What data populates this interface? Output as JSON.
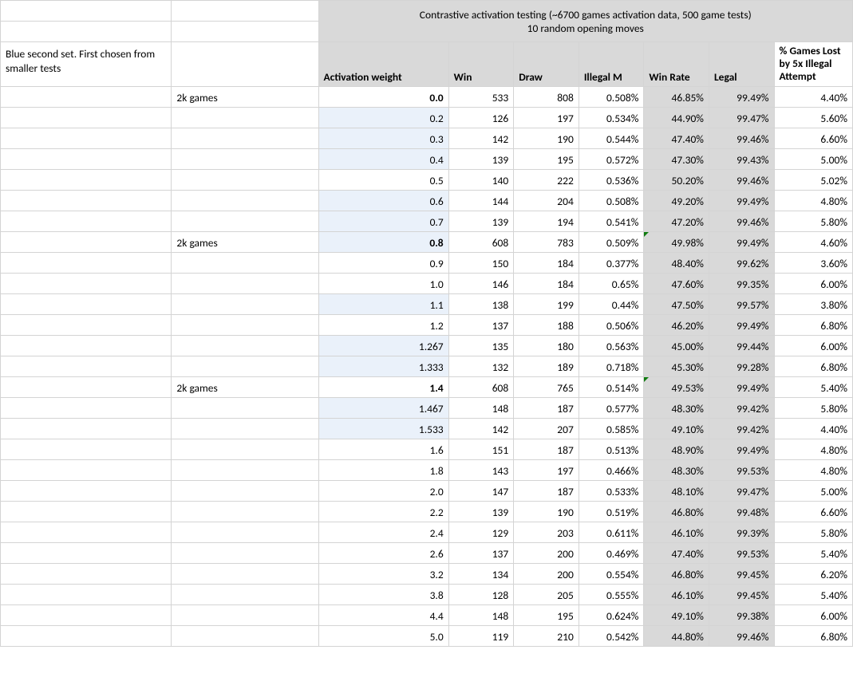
{
  "header": {
    "title_line1": "Contrastive activation testing (~6700 games activation data, 500 game tests)",
    "title_line2": "10 random opening moves",
    "note": "Blue second set. First chosen from smaller tests"
  },
  "columns": {
    "activation": "Activation weight",
    "win": "Win",
    "draw": "Draw",
    "illegal": "Illegal M",
    "winrate": "Win Rate",
    "legal": "Legal",
    "lost": "% Games Lost by 5x Illegal Attempt"
  },
  "games_label": "2k games",
  "rows": [
    {
      "games": "2k games",
      "act": "0.0",
      "win": "533",
      "draw": "808",
      "ill": "0.508%",
      "wr": "46.85%",
      "legal": "99.49%",
      "lost": "4.40%",
      "bold": true,
      "hl": false,
      "mark": false
    },
    {
      "games": "",
      "act": "0.2",
      "win": "126",
      "draw": "197",
      "ill": "0.534%",
      "wr": "44.90%",
      "legal": "99.47%",
      "lost": "5.60%",
      "bold": false,
      "hl": true,
      "mark": false
    },
    {
      "games": "",
      "act": "0.3",
      "win": "142",
      "draw": "190",
      "ill": "0.544%",
      "wr": "47.40%",
      "legal": "99.46%",
      "lost": "6.60%",
      "bold": false,
      "hl": true,
      "mark": false
    },
    {
      "games": "",
      "act": "0.4",
      "win": "139",
      "draw": "195",
      "ill": "0.572%",
      "wr": "47.30%",
      "legal": "99.43%",
      "lost": "5.00%",
      "bold": false,
      "hl": true,
      "mark": false
    },
    {
      "games": "",
      "act": "0.5",
      "win": "140",
      "draw": "222",
      "ill": "0.536%",
      "wr": "50.20%",
      "legal": "99.46%",
      "lost": "5.02%",
      "bold": false,
      "hl": false,
      "mark": false
    },
    {
      "games": "",
      "act": "0.6",
      "win": "144",
      "draw": "204",
      "ill": "0.508%",
      "wr": "49.20%",
      "legal": "99.49%",
      "lost": "4.80%",
      "bold": false,
      "hl": true,
      "mark": false
    },
    {
      "games": "",
      "act": "0.7",
      "win": "139",
      "draw": "194",
      "ill": "0.541%",
      "wr": "47.20%",
      "legal": "99.46%",
      "lost": "5.80%",
      "bold": false,
      "hl": true,
      "mark": false
    },
    {
      "games": "2k games",
      "act": "0.8",
      "win": "608",
      "draw": "783",
      "ill": "0.509%",
      "wr": "49.98%",
      "legal": "99.49%",
      "lost": "4.60%",
      "bold": true,
      "hl": true,
      "mark": true
    },
    {
      "games": "",
      "act": "0.9",
      "win": "150",
      "draw": "184",
      "ill": "0.377%",
      "wr": "48.40%",
      "legal": "99.62%",
      "lost": "3.60%",
      "bold": false,
      "hl": false,
      "mark": false
    },
    {
      "games": "",
      "act": "1.0",
      "win": "146",
      "draw": "184",
      "ill": "0.65%",
      "wr": "47.60%",
      "legal": "99.35%",
      "lost": "6.00%",
      "bold": false,
      "hl": false,
      "mark": false
    },
    {
      "games": "",
      "act": "1.1",
      "win": "138",
      "draw": "199",
      "ill": "0.44%",
      "wr": "47.50%",
      "legal": "99.57%",
      "lost": "3.80%",
      "bold": false,
      "hl": true,
      "mark": false
    },
    {
      "games": "",
      "act": "1.2",
      "win": "137",
      "draw": "188",
      "ill": "0.506%",
      "wr": "46.20%",
      "legal": "99.49%",
      "lost": "6.80%",
      "bold": false,
      "hl": false,
      "mark": false
    },
    {
      "games": "",
      "act": "1.267",
      "win": "135",
      "draw": "180",
      "ill": "0.563%",
      "wr": "45.00%",
      "legal": "99.44%",
      "lost": "6.00%",
      "bold": false,
      "hl": true,
      "mark": false
    },
    {
      "games": "",
      "act": "1.333",
      "win": "132",
      "draw": "189",
      "ill": "0.718%",
      "wr": "45.30%",
      "legal": "99.28%",
      "lost": "6.80%",
      "bold": false,
      "hl": true,
      "mark": false
    },
    {
      "games": "2k games",
      "act": "1.4",
      "win": "608",
      "draw": "765",
      "ill": "0.514%",
      "wr": "49.53%",
      "legal": "99.49%",
      "lost": "5.40%",
      "bold": true,
      "hl": false,
      "mark": true
    },
    {
      "games": "",
      "act": "1.467",
      "win": "148",
      "draw": "187",
      "ill": "0.577%",
      "wr": "48.30%",
      "legal": "99.42%",
      "lost": "5.80%",
      "bold": false,
      "hl": true,
      "mark": false
    },
    {
      "games": "",
      "act": "1.533",
      "win": "142",
      "draw": "207",
      "ill": "0.585%",
      "wr": "49.10%",
      "legal": "99.42%",
      "lost": "4.40%",
      "bold": false,
      "hl": true,
      "mark": false
    },
    {
      "games": "",
      "act": "1.6",
      "win": "151",
      "draw": "187",
      "ill": "0.513%",
      "wr": "48.90%",
      "legal": "99.49%",
      "lost": "4.80%",
      "bold": false,
      "hl": false,
      "mark": false
    },
    {
      "games": "",
      "act": "1.8",
      "win": "143",
      "draw": "197",
      "ill": "0.466%",
      "wr": "48.30%",
      "legal": "99.53%",
      "lost": "4.80%",
      "bold": false,
      "hl": false,
      "mark": false
    },
    {
      "games": "",
      "act": "2.0",
      "win": "147",
      "draw": "187",
      "ill": "0.533%",
      "wr": "48.10%",
      "legal": "99.47%",
      "lost": "5.00%",
      "bold": false,
      "hl": false,
      "mark": false
    },
    {
      "games": "",
      "act": "2.2",
      "win": "139",
      "draw": "190",
      "ill": "0.519%",
      "wr": "46.80%",
      "legal": "99.48%",
      "lost": "6.60%",
      "bold": false,
      "hl": false,
      "mark": false
    },
    {
      "games": "",
      "act": "2.4",
      "win": "129",
      "draw": "203",
      "ill": "0.611%",
      "wr": "46.10%",
      "legal": "99.39%",
      "lost": "5.80%",
      "bold": false,
      "hl": false,
      "mark": false
    },
    {
      "games": "",
      "act": "2.6",
      "win": "137",
      "draw": "200",
      "ill": "0.469%",
      "wr": "47.40%",
      "legal": "99.53%",
      "lost": "5.40%",
      "bold": false,
      "hl": false,
      "mark": false
    },
    {
      "games": "",
      "act": "3.2",
      "win": "134",
      "draw": "200",
      "ill": "0.554%",
      "wr": "46.80%",
      "legal": "99.45%",
      "lost": "6.20%",
      "bold": false,
      "hl": false,
      "mark": false
    },
    {
      "games": "",
      "act": "3.8",
      "win": "128",
      "draw": "205",
      "ill": "0.555%",
      "wr": "46.10%",
      "legal": "99.45%",
      "lost": "5.40%",
      "bold": false,
      "hl": false,
      "mark": false
    },
    {
      "games": "",
      "act": "4.4",
      "win": "148",
      "draw": "195",
      "ill": "0.624%",
      "wr": "49.10%",
      "legal": "99.38%",
      "lost": "6.00%",
      "bold": false,
      "hl": false,
      "mark": false
    },
    {
      "games": "",
      "act": "5.0",
      "win": "119",
      "draw": "210",
      "ill": "0.542%",
      "wr": "44.80%",
      "legal": "99.46%",
      "lost": "6.80%",
      "bold": false,
      "hl": false,
      "mark": false
    }
  ]
}
